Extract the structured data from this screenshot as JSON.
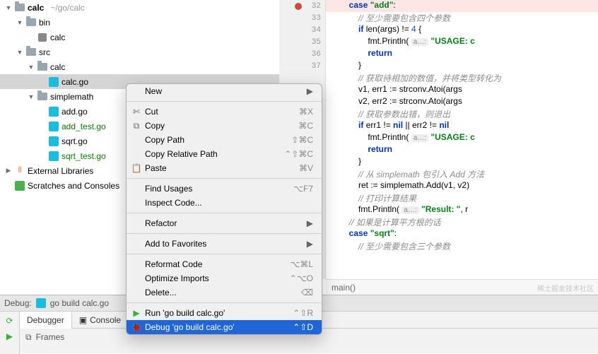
{
  "project": {
    "root": "calc",
    "root_path": "~/go/calc",
    "tree": [
      {
        "indent": 0,
        "arrow": "▼",
        "icon": "folder",
        "label": "calc",
        "path": "~/go/calc",
        "bold": true
      },
      {
        "indent": 1,
        "arrow": "▼",
        "icon": "folder",
        "label": "bin"
      },
      {
        "indent": 2,
        "arrow": "",
        "icon": "exe",
        "label": "calc"
      },
      {
        "indent": 1,
        "arrow": "▼",
        "icon": "folder",
        "label": "src"
      },
      {
        "indent": 2,
        "arrow": "▼",
        "icon": "folder",
        "label": "calc"
      },
      {
        "indent": 3,
        "arrow": "",
        "icon": "go",
        "label": "calc.go",
        "selected": true
      },
      {
        "indent": 2,
        "arrow": "▼",
        "icon": "folder",
        "label": "simplemath"
      },
      {
        "indent": 3,
        "arrow": "",
        "icon": "go",
        "label": "add.go"
      },
      {
        "indent": 3,
        "arrow": "",
        "icon": "go",
        "label": "add_test.go",
        "added": true
      },
      {
        "indent": 3,
        "arrow": "",
        "icon": "go",
        "label": "sqrt.go"
      },
      {
        "indent": 3,
        "arrow": "",
        "icon": "go",
        "label": "sqrt_test.go",
        "added": true
      },
      {
        "indent": 0,
        "arrow": "▶",
        "icon": "lib",
        "label": "External Libraries"
      },
      {
        "indent": 0,
        "arrow": "",
        "icon": "scratch",
        "label": "Scratches and Consoles"
      }
    ]
  },
  "gutter": {
    "start": 32,
    "count": 22,
    "breakpoint": 32
  },
  "code": [
    {
      "kind": "bp",
      "tokens": [
        [
          "        ",
          "co"
        ],
        [
          "case ",
          "kw"
        ],
        [
          "\"add\"",
          "str"
        ],
        [
          ":",
          ""
        ]
      ]
    },
    {
      "tokens": [
        [
          "            ",
          "co"
        ],
        [
          "// 至少需要包含四个参数",
          "cmt"
        ]
      ]
    },
    {
      "tokens": [
        [
          "            ",
          "co"
        ],
        [
          "if ",
          "kw"
        ],
        [
          "len(args) != ",
          "co"
        ],
        [
          "4",
          "num"
        ],
        [
          " {",
          ""
        ]
      ]
    },
    {
      "tokens": [
        [
          "                fmt.Println( ",
          "co"
        ],
        [
          "a…:",
          "hint"
        ],
        [
          " ",
          "co"
        ],
        [
          "\"USAGE: c",
          "str"
        ]
      ]
    },
    {
      "tokens": [
        [
          "                ",
          "co"
        ],
        [
          "return",
          "kw"
        ]
      ]
    },
    {
      "tokens": [
        [
          "            }",
          ""
        ]
      ]
    },
    {
      "tokens": [
        [
          "            ",
          "co"
        ],
        [
          "// 获取待相加的数值，并将类型转化为",
          "cmt"
        ]
      ]
    },
    {
      "tokens": [
        [
          "            v1, err1 := strconv.Atoi(args",
          ""
        ]
      ]
    },
    {
      "tokens": [
        [
          "            v2, err2 := strconv.Atoi(args",
          ""
        ]
      ]
    },
    {
      "tokens": [
        [
          "            ",
          "co"
        ],
        [
          "// 获取参数出错，则退出",
          "cmt"
        ]
      ]
    },
    {
      "tokens": [
        [
          "            ",
          "co"
        ],
        [
          "if ",
          "kw"
        ],
        [
          "err1 != ",
          "co"
        ],
        [
          "nil",
          "kw"
        ],
        [
          " || err2 != ",
          "co"
        ],
        [
          "nil",
          "kw"
        ]
      ]
    },
    {
      "tokens": [
        [
          "                fmt.Println( ",
          "co"
        ],
        [
          "a…:",
          "hint"
        ],
        [
          " ",
          "co"
        ],
        [
          "\"USAGE: c",
          "str"
        ]
      ]
    },
    {
      "tokens": [
        [
          "                ",
          "co"
        ],
        [
          "return",
          "kw"
        ]
      ]
    },
    {
      "tokens": [
        [
          "            }",
          ""
        ]
      ]
    },
    {
      "tokens": [
        [
          "            ",
          "co"
        ],
        [
          "// 从 ",
          "cmt"
        ],
        [
          "simplemath",
          "cmt"
        ],
        [
          " 包引入 ",
          "cmt"
        ],
        [
          "Add",
          "cmt"
        ],
        [
          " 方法",
          "cmt"
        ]
      ]
    },
    {
      "tokens": [
        [
          "            ret := simplemath.Add(v1, v2)",
          ""
        ]
      ]
    },
    {
      "tokens": [
        [
          "            ",
          "co"
        ],
        [
          "// 打印计算结果",
          "cmt"
        ]
      ]
    },
    {
      "tokens": [
        [
          "            fmt.Println( ",
          "co"
        ],
        [
          "a…:",
          "hint"
        ],
        [
          " ",
          "co"
        ],
        [
          "\"Result: \"",
          "str"
        ],
        [
          ", r",
          "co"
        ]
      ]
    },
    {
      "tokens": [
        [
          "        ",
          "co"
        ],
        [
          "// 如果是计算平方根的话",
          "cmt"
        ]
      ]
    },
    {
      "tokens": [
        [
          "        ",
          "co"
        ],
        [
          "case ",
          "kw"
        ],
        [
          "\"sqrt\"",
          "str"
        ],
        [
          ":",
          ""
        ]
      ]
    },
    {
      "tokens": [
        [
          "            ",
          "co"
        ],
        [
          "// 至少需要包含三个参数",
          "cmt"
        ]
      ]
    }
  ],
  "breadcrumb": "main()",
  "debug": {
    "title": "Debug:",
    "config": "go build calc.go",
    "tabs": [
      {
        "label": "Debugger",
        "active": true
      },
      {
        "label": "Console",
        "active": false
      }
    ],
    "frames_label": "Frames"
  },
  "context_menu": [
    {
      "type": "item",
      "label": "New",
      "sub": true
    },
    {
      "type": "sep"
    },
    {
      "type": "item",
      "label": "Cut",
      "icon": "✄",
      "shortcut": "⌘X"
    },
    {
      "type": "item",
      "label": "Copy",
      "icon": "⧉",
      "shortcut": "⌘C"
    },
    {
      "type": "item",
      "label": "Copy Path",
      "shortcut": "⇧⌘C"
    },
    {
      "type": "item",
      "label": "Copy Relative Path",
      "shortcut": "⌃⇧⌘C"
    },
    {
      "type": "item",
      "label": "Paste",
      "icon": "📋",
      "shortcut": "⌘V"
    },
    {
      "type": "sep"
    },
    {
      "type": "item",
      "label": "Find Usages",
      "shortcut": "⌥F7"
    },
    {
      "type": "item",
      "label": "Inspect Code..."
    },
    {
      "type": "sep"
    },
    {
      "type": "item",
      "label": "Refactor",
      "sub": true
    },
    {
      "type": "sep"
    },
    {
      "type": "item",
      "label": "Add to Favorites",
      "sub": true
    },
    {
      "type": "sep"
    },
    {
      "type": "item",
      "label": "Reformat Code",
      "shortcut": "⌥⌘L"
    },
    {
      "type": "item",
      "label": "Optimize Imports",
      "shortcut": "⌃⌥O"
    },
    {
      "type": "item",
      "label": "Delete...",
      "shortcut": "⌫"
    },
    {
      "type": "sep"
    },
    {
      "type": "item",
      "label": "Run 'go build calc.go'",
      "icon": "▶",
      "icon_color": "#4a4",
      "shortcut": "⌃⇧R"
    },
    {
      "type": "item",
      "label": "Debug 'go build calc.go'",
      "icon": "🐞",
      "shortcut": "⌃⇧D",
      "hl": true
    }
  ],
  "watermark": "稀土掘金技术社区"
}
